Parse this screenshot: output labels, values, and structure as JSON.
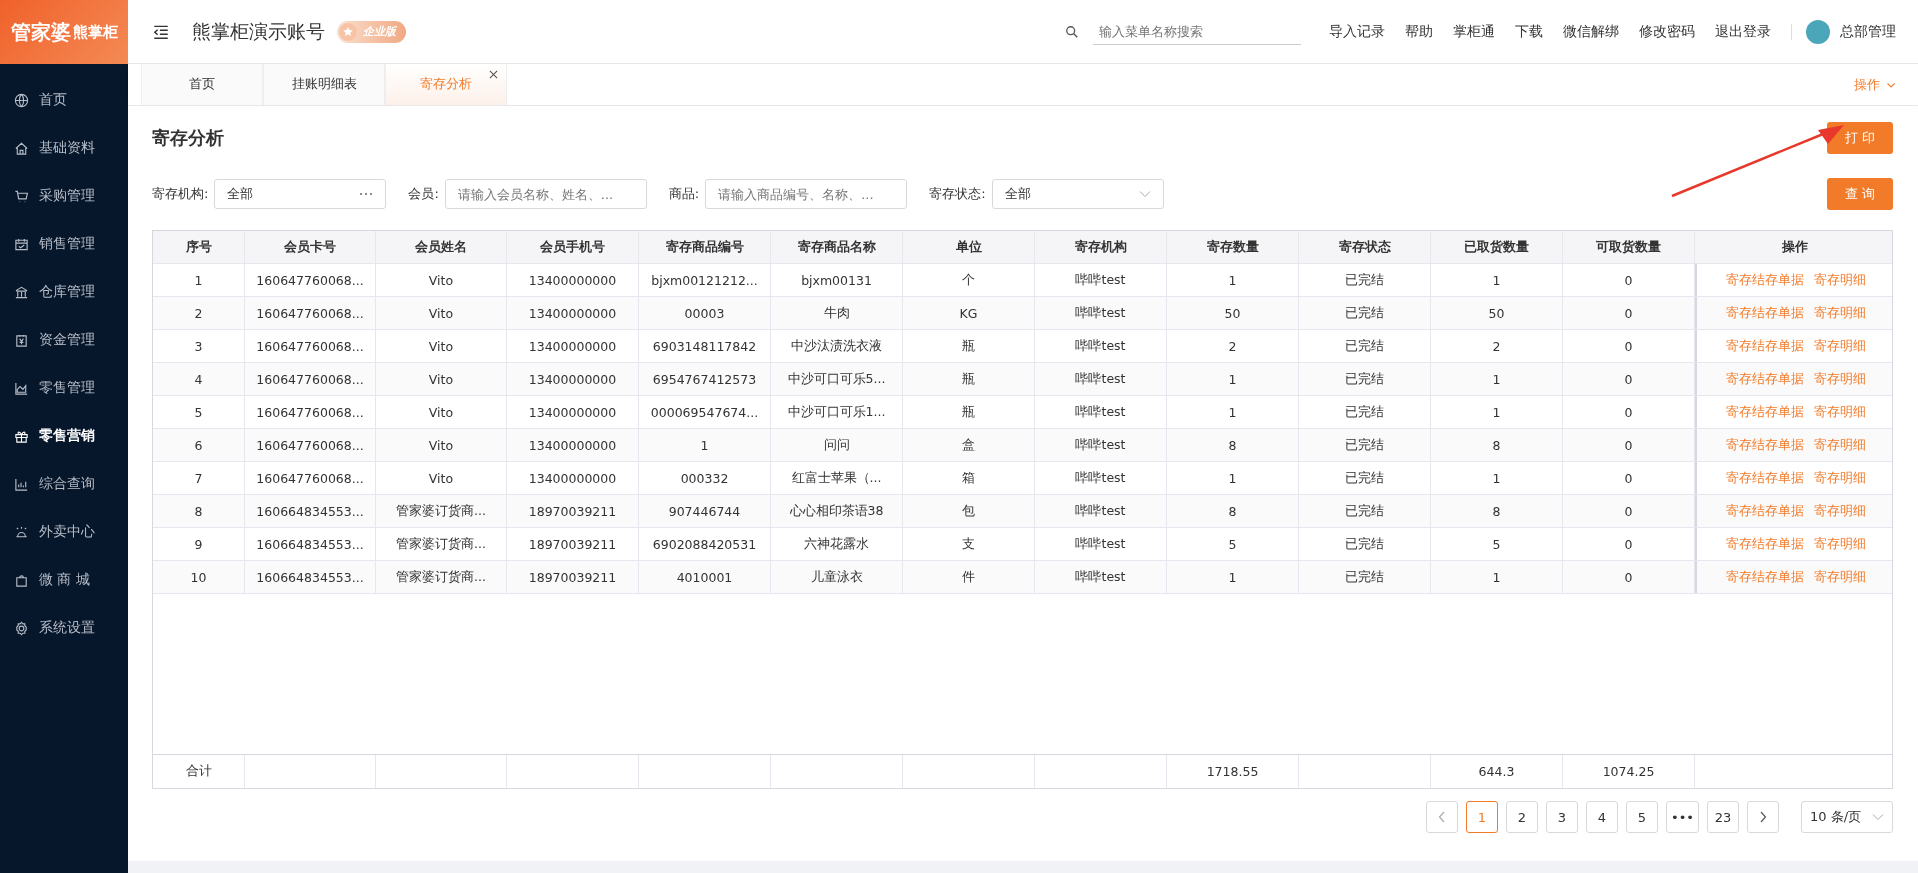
{
  "logo": {
    "brand": "管家婆",
    "product": "熊掌柜"
  },
  "sidebar": {
    "items": [
      {
        "label": "首页",
        "selected": false
      },
      {
        "label": "基础资料",
        "selected": false
      },
      {
        "label": "采购管理",
        "selected": false
      },
      {
        "label": "销售管理",
        "selected": false
      },
      {
        "label": "仓库管理",
        "selected": false
      },
      {
        "label": "资金管理",
        "selected": false
      },
      {
        "label": "零售管理",
        "selected": false
      },
      {
        "label": "零售营销",
        "selected": true
      },
      {
        "label": "综合查询",
        "selected": false
      },
      {
        "label": "外卖中心",
        "selected": false
      },
      {
        "label": "微 商 城",
        "selected": false
      },
      {
        "label": "系统设置",
        "selected": false
      }
    ]
  },
  "header": {
    "account": "熊掌柜演示账号",
    "edition": "企业版",
    "search": {
      "placeholder": "输入菜单名称搜索"
    },
    "links": [
      "导入记录",
      "帮助",
      "掌柜通",
      "下载",
      "微信解绑",
      "修改密码",
      "退出登录"
    ],
    "user": "总部管理"
  },
  "tabs": [
    {
      "label": "首页",
      "selected": false
    },
    {
      "label": "挂账明细表",
      "selected": false
    },
    {
      "label": "寄存分析",
      "selected": true
    }
  ],
  "tab_actions": "操作",
  "page": {
    "title": "寄存分析",
    "print_button": "打 印",
    "query_button": "查 询"
  },
  "filters": [
    {
      "kind": "picker",
      "label": "寄存机构:",
      "value": "全部"
    },
    {
      "kind": "input",
      "label": "会员:",
      "placeholder": "请输入会员名称、姓名、..."
    },
    {
      "kind": "input",
      "label": "商品:",
      "placeholder": "请输入商品编号、名称、..."
    },
    {
      "kind": "select",
      "label": "寄存状态:",
      "value": "全部"
    }
  ],
  "table": {
    "columns": [
      "序号",
      "会员卡号",
      "会员姓名",
      "会员手机号",
      "寄存商品编号",
      "寄存商品名称",
      "单位",
      "寄存机构",
      "寄存数量",
      "寄存状态",
      "已取货数量",
      "可取货数量",
      "操作"
    ],
    "rows": [
      {
        "cells": [
          "1",
          "160647760068...",
          "Vito",
          "13400000000",
          "bjxm00121212...",
          "bjxm00131",
          "个",
          "哔哔test",
          "1",
          "已完结",
          "1",
          "0"
        ],
        "actions": [
          "寄存结存单据",
          "寄存明细"
        ]
      },
      {
        "cells": [
          "2",
          "160647760068...",
          "Vito",
          "13400000000",
          "00003",
          "牛肉",
          "KG",
          "哔哔test",
          "50",
          "已完结",
          "50",
          "0"
        ],
        "actions": [
          "寄存结存单据",
          "寄存明细"
        ]
      },
      {
        "cells": [
          "3",
          "160647760068...",
          "Vito",
          "13400000000",
          "6903148117842",
          "中沙汰渍洗衣液",
          "瓶",
          "哔哔test",
          "2",
          "已完结",
          "2",
          "0"
        ],
        "actions": [
          "寄存结存单据",
          "寄存明细"
        ]
      },
      {
        "cells": [
          "4",
          "160647760068...",
          "Vito",
          "13400000000",
          "6954767412573",
          "中沙可口可乐5...",
          "瓶",
          "哔哔test",
          "1",
          "已完结",
          "1",
          "0"
        ],
        "actions": [
          "寄存结存单据",
          "寄存明细"
        ]
      },
      {
        "cells": [
          "5",
          "160647760068...",
          "Vito",
          "13400000000",
          "000069547674...",
          "中沙可口可乐1...",
          "瓶",
          "哔哔test",
          "1",
          "已完结",
          "1",
          "0"
        ],
        "actions": [
          "寄存结存单据",
          "寄存明细"
        ]
      },
      {
        "cells": [
          "6",
          "160647760068...",
          "Vito",
          "13400000000",
          "1",
          "问问",
          "盒",
          "哔哔test",
          "8",
          "已完结",
          "8",
          "0"
        ],
        "actions": [
          "寄存结存单据",
          "寄存明细"
        ]
      },
      {
        "cells": [
          "7",
          "160647760068...",
          "Vito",
          "13400000000",
          "000332",
          "红富士苹果（...",
          "箱",
          "哔哔test",
          "1",
          "已完结",
          "1",
          "0"
        ],
        "actions": [
          "寄存结存单据",
          "寄存明细"
        ]
      },
      {
        "cells": [
          "8",
          "160664834553...",
          "管家婆订货商...",
          "18970039211",
          "907446744",
          "心心相印茶语38",
          "包",
          "哔哔test",
          "8",
          "已完结",
          "8",
          "0"
        ],
        "actions": [
          "寄存结存单据",
          "寄存明细"
        ]
      },
      {
        "cells": [
          "9",
          "160664834553...",
          "管家婆订货商...",
          "18970039211",
          "6902088420531",
          "六神花露水",
          "支",
          "哔哔test",
          "5",
          "已完结",
          "5",
          "0"
        ],
        "actions": [
          "寄存结存单据",
          "寄存明细"
        ]
      },
      {
        "cells": [
          "10",
          "160664834553...",
          "管家婆订货商...",
          "18970039211",
          "4010001",
          "儿童泳衣",
          "件",
          "哔哔test",
          "1",
          "已完结",
          "1",
          "0"
        ],
        "actions": [
          "寄存结存单据",
          "寄存明细"
        ]
      }
    ],
    "totals": {
      "label": "合计",
      "stored_quantity": "1718.55",
      "picked_quantity": "644.3",
      "available_quantity": "1074.25"
    }
  },
  "pagination": {
    "pages": [
      {
        "label": "1",
        "selected": true
      },
      {
        "label": "2",
        "selected": false
      },
      {
        "label": "3",
        "selected": false
      },
      {
        "label": "4",
        "selected": false
      },
      {
        "label": "5",
        "selected": false
      },
      {
        "label": "•••",
        "selected": false
      },
      {
        "label": "23",
        "selected": false
      }
    ],
    "page_size": "10 条/页"
  }
}
